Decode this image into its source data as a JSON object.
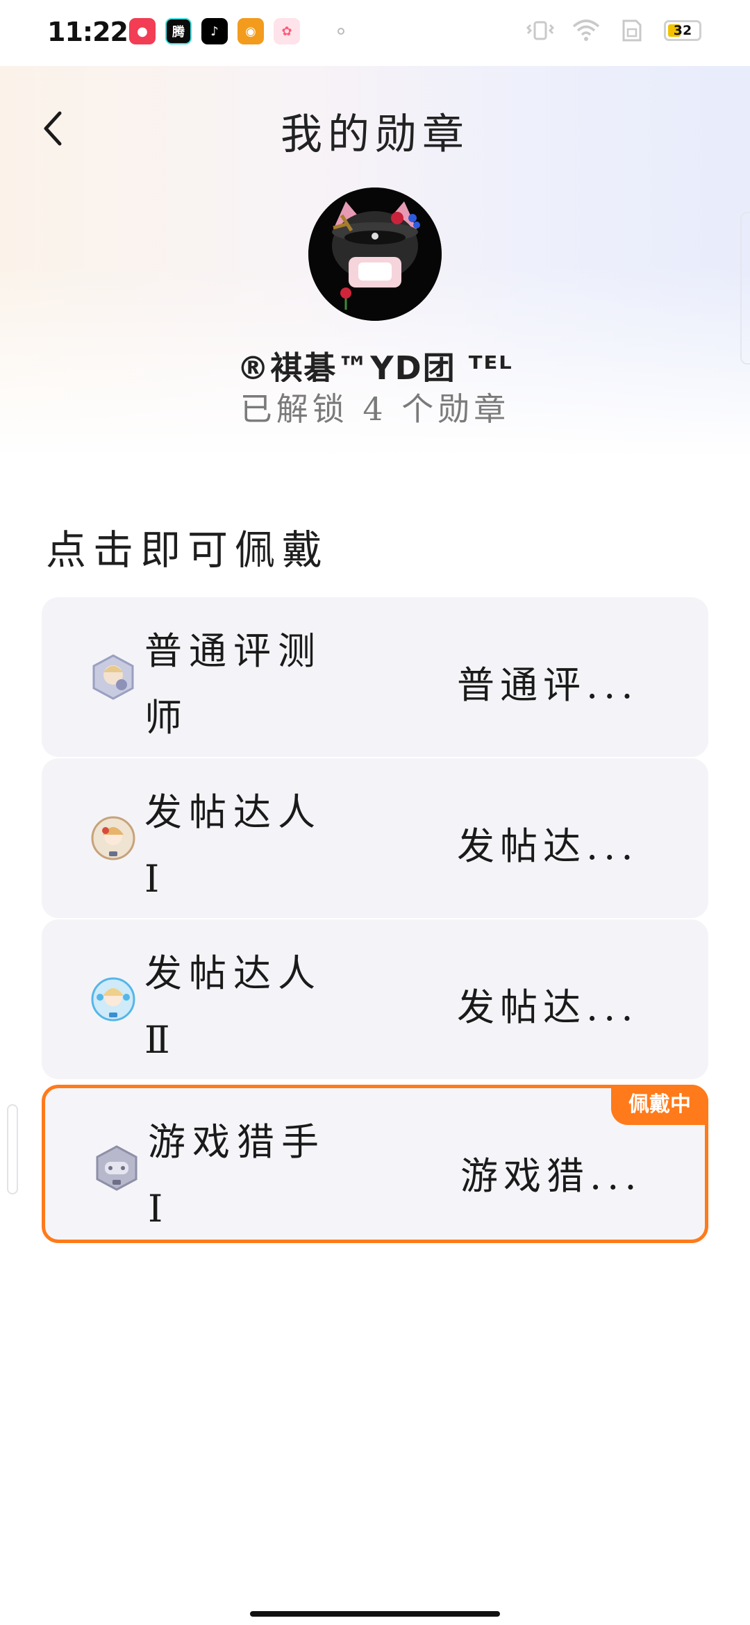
{
  "status_bar": {
    "time": "11:22",
    "apps": [
      {
        "name": "video-recorder-app-icon",
        "glyph": "●",
        "bg": "#f23d54"
      },
      {
        "name": "news-app-icon",
        "glyph": "腾",
        "bg": "#0b0b0b"
      },
      {
        "name": "tiktok-app-icon",
        "glyph": "♪",
        "bg": "#000000"
      },
      {
        "name": "animal-app-icon",
        "glyph": "◉",
        "bg": "#f29b1d"
      },
      {
        "name": "chat-app-icon",
        "glyph": "✿",
        "bg": "#ff5a7a"
      }
    ],
    "battery": "32"
  },
  "header": {
    "title": "我的勋章"
  },
  "profile": {
    "username": "®褀碁™YD团 ᵀᴱᴸ",
    "unlocked_text": "已解锁 4 个勋章"
  },
  "section": {
    "title": "点击即可佩戴"
  },
  "badges": [
    {
      "name": "普通评测师",
      "desc": "普通评...",
      "icon_color": "#9aa0c0",
      "selected": false
    },
    {
      "name": "发帖达人Ⅰ",
      "desc": "发帖达...",
      "icon_color": "#c7a27a",
      "selected": false
    },
    {
      "name": "发帖达人Ⅱ",
      "desc": "发帖达...",
      "icon_color": "#55b6e8",
      "selected": false
    },
    {
      "name": "游戏猎手Ⅰ",
      "desc": "游戏猎...",
      "icon_color": "#8e8fa8",
      "selected": true
    }
  ],
  "wearing_label": "佩戴中",
  "colors": {
    "accent": "#ff7a1a",
    "card_bg": "#f4f4f8"
  }
}
